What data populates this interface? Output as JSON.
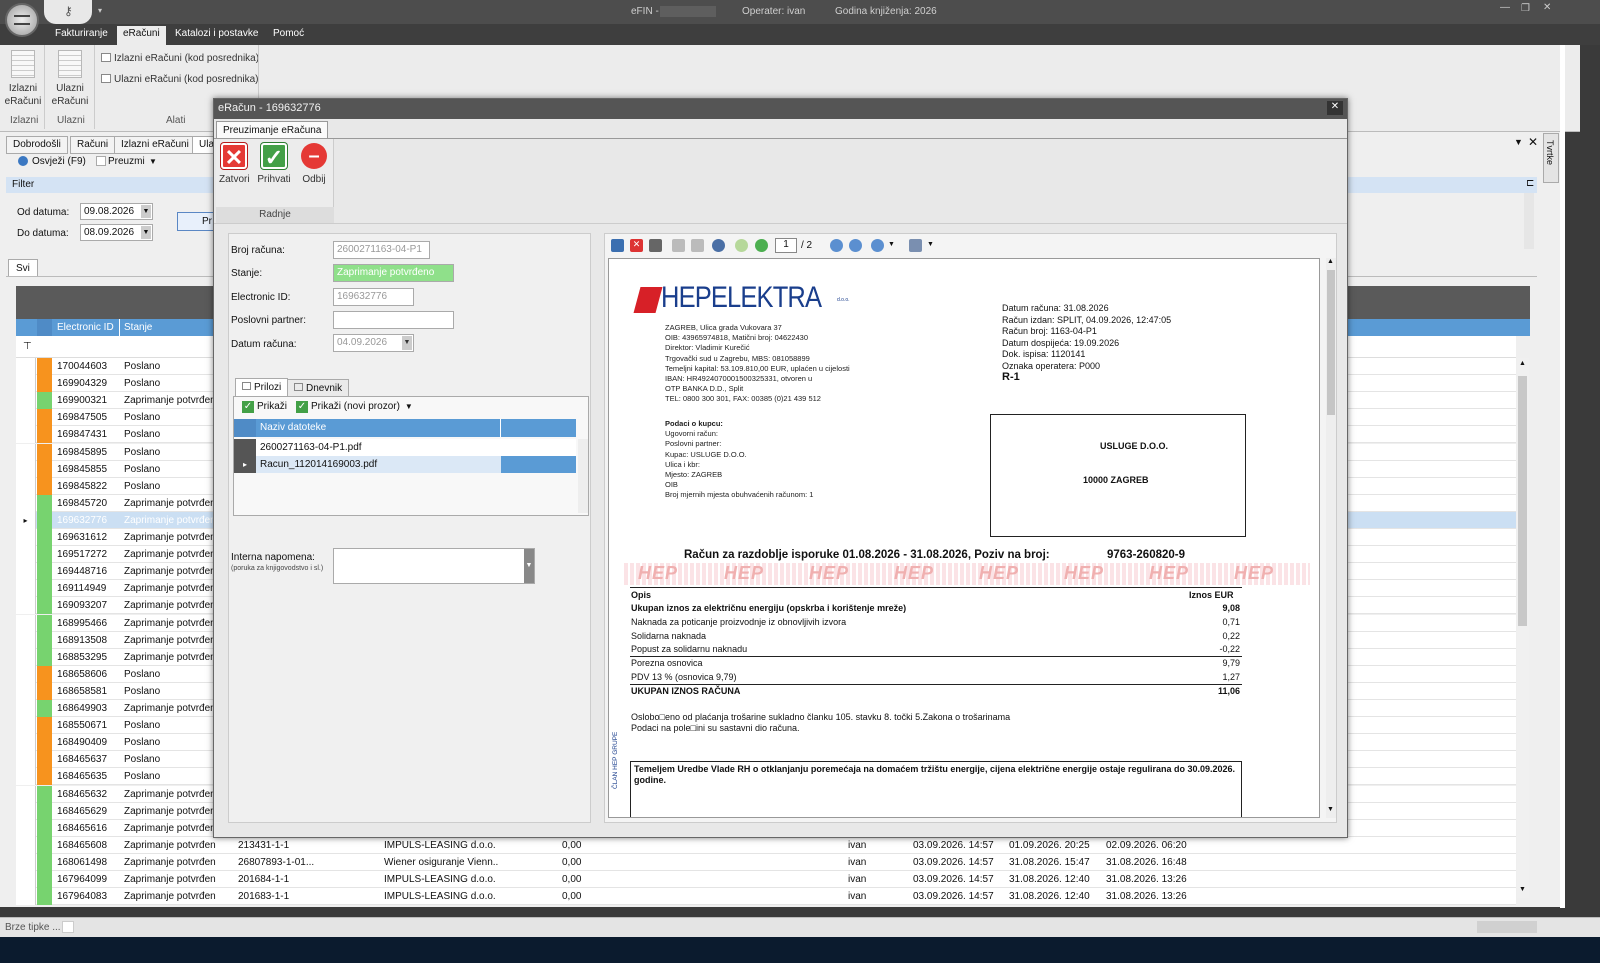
{
  "app": {
    "title": "eFIN -",
    "operator": "Operater: ivan",
    "year": "Godina knjiženja: 2026"
  },
  "menu": {
    "tabs": [
      "Fakturiranje",
      "eRačuni",
      "Katalozi i postavke",
      "Pomoć"
    ]
  },
  "ribbon": {
    "izlazni": "Izlazni eRačuni",
    "ulazni": "Ulazni eRačuni",
    "small1": "Izlazni eRačuni (kod posrednika)",
    "small2": "Ulazni eRačuni (kod posrednika)",
    "g_izlazni": "Izlazni",
    "g_ulazni": "Ulazni",
    "g_alati": "Alati"
  },
  "doctabs": [
    "Dobrodošli",
    "Računi",
    "Izlazni eRačuni",
    "Ula"
  ],
  "toolbar": {
    "refresh": "Osvježi (F9)",
    "preuzmi": "Preuzmi"
  },
  "filter": {
    "title": "Filter",
    "od_label": "Od datuma:",
    "od": "09.08.2026",
    "do_label": "Do datuma:",
    "do": "08.09.2026",
    "btn": "Pr"
  },
  "gridtab": "Svi",
  "grid": {
    "col_id": "Electronic ID",
    "col_stanje": "Stanje",
    "rows": [
      {
        "id": "170044603",
        "st": "Poslano",
        "c": "#f7931e"
      },
      {
        "id": "169904329",
        "st": "Poslano",
        "c": "#f7931e"
      },
      {
        "id": "169900321",
        "st": "Zaprimanje potvrđeno",
        "c": "#77d36f"
      },
      {
        "id": "169847505",
        "st": "Poslano",
        "c": "#f7931e"
      },
      {
        "id": "169847431",
        "st": "Poslano",
        "c": "#f7931e"
      },
      {
        "id": "169845895",
        "st": "Poslano",
        "c": "#f7931e"
      },
      {
        "id": "169845855",
        "st": "Poslano",
        "c": "#f7931e"
      },
      {
        "id": "169845822",
        "st": "Poslano",
        "c": "#f7931e"
      },
      {
        "id": "169845720",
        "st": "Zaprimanje potvrđeno",
        "c": "#77d36f"
      },
      {
        "id": "169632776",
        "st": "Zaprimanje potvrđeno",
        "c": "#77d36f",
        "sel": true
      },
      {
        "id": "169631612",
        "st": "Zaprimanje potvrđeno",
        "c": "#77d36f"
      },
      {
        "id": "169517272",
        "st": "Zaprimanje potvrđeno",
        "c": "#77d36f"
      },
      {
        "id": "169448716",
        "st": "Zaprimanje potvrđeno",
        "c": "#77d36f"
      },
      {
        "id": "169114949",
        "st": "Zaprimanje potvrđeno",
        "c": "#77d36f"
      },
      {
        "id": "169093207",
        "st": "Zaprimanje potvrđeno",
        "c": "#77d36f"
      },
      {
        "id": "168995466",
        "st": "Zaprimanje potvrđeno",
        "c": "#77d36f"
      },
      {
        "id": "168913508",
        "st": "Zaprimanje potvrđeno",
        "c": "#77d36f"
      },
      {
        "id": "168853295",
        "st": "Zaprimanje potvrđeno",
        "c": "#77d36f"
      },
      {
        "id": "168658606",
        "st": "Poslano",
        "c": "#f7931e"
      },
      {
        "id": "168658581",
        "st": "Poslano",
        "c": "#f7931e"
      },
      {
        "id": "168649903",
        "st": "Zaprimanje potvrđeno",
        "c": "#77d36f"
      },
      {
        "id": "168550671",
        "st": "Poslano",
        "c": "#f7931e"
      },
      {
        "id": "168490409",
        "st": "Poslano",
        "c": "#f7931e"
      },
      {
        "id": "168465637",
        "st": "Poslano",
        "c": "#f7931e"
      },
      {
        "id": "168465635",
        "st": "Poslano",
        "c": "#f7931e"
      },
      {
        "id": "168465632",
        "st": "Zaprimanje potvrđeno",
        "c": "#77d36f"
      },
      {
        "id": "168465629",
        "st": "Zaprimanje potvrđeno",
        "c": "#77d36f"
      },
      {
        "id": "168465616",
        "st": "Zaprimanje potvrđeno",
        "c": "#77d36f"
      },
      {
        "id": "168465608",
        "st": "Zaprimanje potvrđeno",
        "c": "#77d36f",
        "br": "213431-1-1",
        "pp": "IMPULS-LEASING d.o.o.",
        "iz": "0,00",
        "u": "ivan",
        "d1": "03.09.2026. 14:57",
        "d2": "01.09.2026. 20:25",
        "d3": "02.09.2026. 06:20"
      },
      {
        "id": "168061498",
        "st": "Zaprimanje potvrđeno",
        "c": "#77d36f",
        "br": "26807893-1-01...",
        "pp": "Wiener osiguranje Vienn...",
        "iz": "0,00",
        "u": "ivan",
        "d1": "03.09.2026. 14:57",
        "d2": "31.08.2026. 15:47",
        "d3": "31.08.2026. 16:48"
      },
      {
        "id": "167964099",
        "st": "Zaprimanje potvrđeno",
        "c": "#77d36f",
        "br": "201684-1-1",
        "pp": "IMPULS-LEASING d.o.o.",
        "iz": "0,00",
        "u": "ivan",
        "d1": "03.09.2026. 14:57",
        "d2": "31.08.2026. 12:40",
        "d3": "31.08.2026. 13:26"
      },
      {
        "id": "167964083",
        "st": "Zaprimanje potvrđeno",
        "c": "#77d36f",
        "br": "201683-1-1",
        "pp": "IMPULS-LEASING d.o.o.",
        "iz": "0,00",
        "u": "ivan",
        "d1": "03.09.2026. 14:57",
        "d2": "31.08.2026. 12:40",
        "d3": "31.08.2026. 13:26"
      }
    ]
  },
  "status": {
    "brze": "Brze tipke ..."
  },
  "side": {
    "tvrtke": "Tvrtke"
  },
  "dialog": {
    "title": "eRačun - 169632776",
    "tab": "Preuzimanje eRačuna",
    "zatvori": "Zatvori",
    "prihvati": "Prihvati",
    "odbij": "Odbij",
    "group": "Radnje",
    "f_broj": "Broj računa:",
    "v_broj": "2600271163-04-P1",
    "f_stanje": "Stanje:",
    "v_stanje": "Zaprimanje potvrđeno",
    "f_eid": "Electronic ID:",
    "v_eid": "169632776",
    "f_partner": "Poslovni partner:",
    "v_partner": "",
    "f_datum": "Datum računa:",
    "v_datum": "04.09.2026",
    "tab_prilozi": "Prilozi",
    "tab_dnevnik": "Dnevnik",
    "prikazi": "Prikaži",
    "prikazi_novi": "Prikaži (novi prozor)",
    "col_naziv": "Naziv datoteke",
    "files": [
      "2600271163-04-P1.pdf",
      "Racun_112014169003.pdf"
    ],
    "napomena": "Interna napomena:",
    "napomena_sub": "(poruka za knjigovodstvo i sl.)",
    "page_num": "1",
    "page_total": "/ 2"
  },
  "invoice": {
    "brand": "HEPELEKTRA",
    "brand_suffix": "d.o.o.",
    "addr": [
      "ZAGREB, Ulica grada Vukovara 37",
      "OIB: 43965974818, Matični broj: 04622430",
      "Direktor: Vladimir Kurečić",
      "Trgovački sud u Zagrebu, MBS: 081058899",
      "Temeljni kapital: 53.109.810,00 EUR, uplaćen u cijelosti",
      "IBAN: HR4924070001500325331, otvoren u",
      "OTP BANKA D.D., Split",
      "TEL: 0800 300 301, FAX: 00385 (0)21 439 512"
    ],
    "meta": [
      "Datum računa: 31.08.2026",
      "Račun izdan: SPLIT, 04.09.2026, 12:47:05",
      "Račun broj: 1163-04-P1",
      "Datum dospijeća: 19.09.2026",
      "Dok. ispisa: 1120141",
      "Oznaka operatera: P000"
    ],
    "r1": "R-1",
    "kupac": [
      "Podaci o kupcu:",
      "Ugovorni račun:",
      "Poslovni partner:",
      "Kupac: USLUGE D.O.O.",
      "Ulica i kbr:",
      "Mjesto: ZAGREB",
      "OIB",
      "Broj mjernih mjesta obuhvaćenih računom: 1"
    ],
    "box1": "USLUGE D.O.O.",
    "box2": "10000 ZAGREB",
    "headline": "Račun za razdoblje isporuke 01.08.2026 - 31.08.2026, Poziv na broj:",
    "poziv": "9763-260820-9",
    "hep": "HEP",
    "opis": "Opis",
    "iznos": "Iznos EUR",
    "lines": [
      [
        "Ukupan iznos za električnu energiju (opskrba i korištenje mreže)",
        "9,08"
      ],
      [
        "Naknada za poticanje proizvodnje iz obnovljivih izvora",
        "0,71"
      ],
      [
        "Solidarna naknada",
        "0,22"
      ],
      [
        "Popust za solidarnu naknadu",
        "-0,22"
      ],
      [
        "Porezna osnovica",
        "9,79"
      ],
      [
        "PDV 13 % (osnovica 9,79)",
        "1,27"
      ],
      [
        "UKUPAN IZNOS RAČUNA",
        "11,06"
      ]
    ],
    "note1": "Oslobo□eno od plaćanja trošarine sukladno članku 105. stavku 8. točki 5.Zakona o trošarinama",
    "note2": "Podaci na pole□ini su sastavni dio računa.",
    "side": "ČLAN HEP GRUPE",
    "box3": "Temeljem Uredbe Vlade RH o otklanjanju poremećaja na domaćem tržištu energije, cijena električne energije ostaje regulirana do 30.09.2026. godine."
  }
}
